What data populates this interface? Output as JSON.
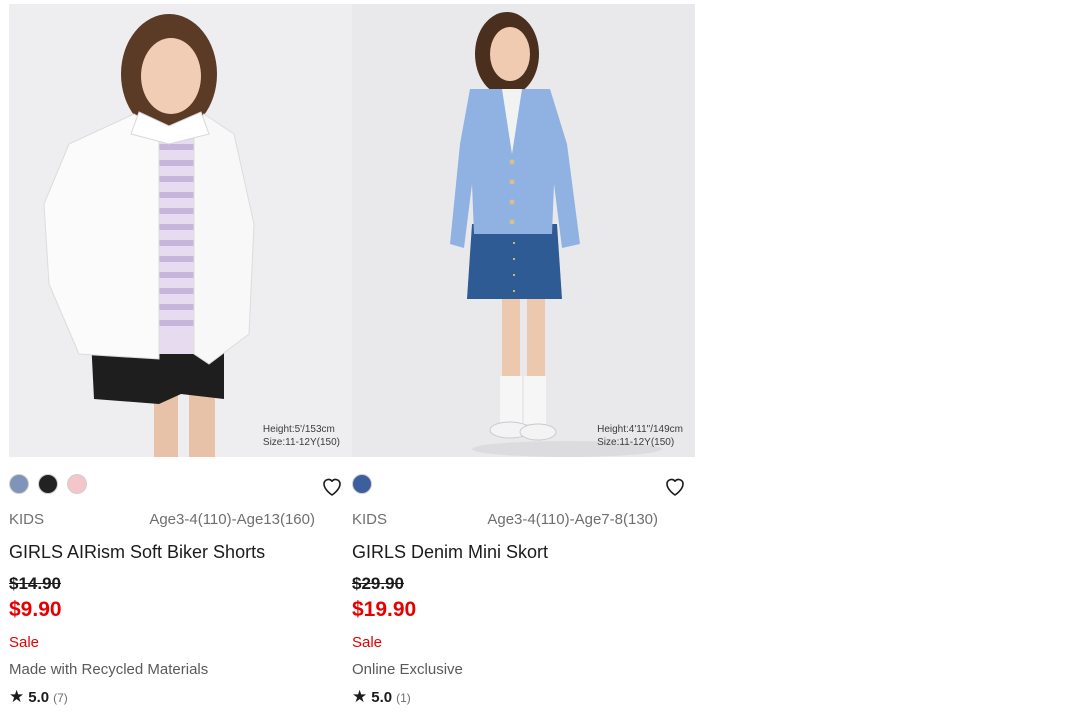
{
  "products": [
    {
      "photo_caption_line1": "Height:5'/153cm",
      "photo_caption_line2": "Size:11-12Y(150)",
      "swatches": [
        "#7f94b8",
        "#222222",
        "#f3c6cc"
      ],
      "category": "KIDS",
      "sizes": "Age3-4(110)-Age13(160)",
      "name": "GIRLS AIRism Soft Biker Shorts",
      "original_price": "$14.90",
      "sale_price": "$9.90",
      "flag": "Sale",
      "note": "Made with Recycled Materials",
      "rating": "5.0",
      "review_count": "(7)"
    },
    {
      "photo_caption_line1": "Height:4'11\"/149cm",
      "photo_caption_line2": "Size:11-12Y(150)",
      "swatches": [
        "#3d5f9e"
      ],
      "category": "KIDS",
      "sizes": "Age3-4(110)-Age7-8(130)",
      "name": "GIRLS Denim Mini Skort",
      "original_price": "$29.90",
      "sale_price": "$19.90",
      "flag": "Sale",
      "note": "Online Exclusive",
      "rating": "5.0",
      "review_count": "(1)"
    }
  ],
  "icons": {
    "favorite": "heart-outline-icon",
    "rating": "star-icon"
  },
  "colors": {
    "sale": "#e60000",
    "text": "#1b1b1b",
    "muted": "#6f6f6f"
  }
}
